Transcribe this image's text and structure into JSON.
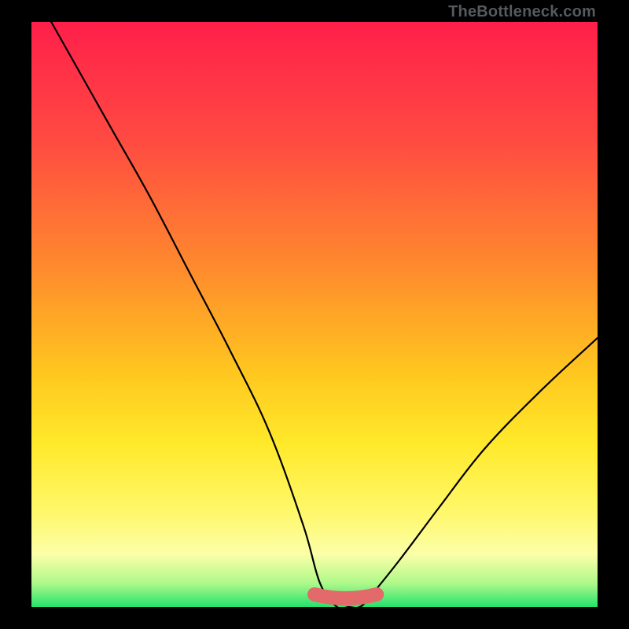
{
  "attribution": "TheBottleneck.com",
  "colors": {
    "background": "#000000",
    "curve": "#000000",
    "near_zero_band": "#e36a6a",
    "green": "#22e36c",
    "yellow": "#ffe92a",
    "red": "#ff1f4a"
  },
  "chart_data": {
    "type": "line",
    "title": "",
    "xlabel": "",
    "ylabel": "",
    "ylim": [
      0,
      100
    ],
    "xlim": [
      0,
      100
    ],
    "series": [
      {
        "name": "bottleneck-curve",
        "x": [
          0,
          7,
          14,
          21,
          28,
          35,
          42,
          48,
          51,
          54,
          56,
          58,
          60,
          65,
          72,
          80,
          90,
          100
        ],
        "y": [
          106,
          94,
          82,
          70,
          57,
          44,
          30,
          14,
          4,
          0,
          0,
          0,
          2,
          8,
          17,
          27,
          37,
          46
        ]
      },
      {
        "name": "near-zero-region",
        "x": [
          50,
          61
        ],
        "y": [
          0,
          0
        ]
      }
    ],
    "interpretation": "Height encodes bottleneck percentage; the background gradient maps value to color — green near 0 (no bottleneck), rising through yellow/orange to red near 100 (severe bottleneck). The thick salmon segment marks the near-zero ideal region."
  }
}
